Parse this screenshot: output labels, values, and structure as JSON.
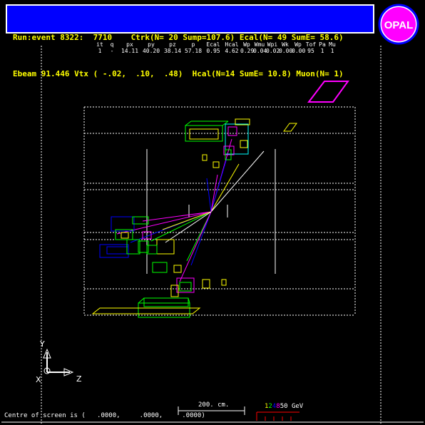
{
  "header": {
    "line1": "Run:event 8322:  7710    Ctrk(N= 20 Sump=107.6) Ecal(N= 49 SumE= 58.6)",
    "line2": "Ebeam 91.446 Vtx ( -.02,  .10,  .48)  Hcal(N=14 SumE= 10.8) Muon(N= 1)"
  },
  "logo": {
    "text": "OPAL"
  },
  "track_table": {
    "headers": [
      "it",
      "q",
      "px",
      "py",
      "pz",
      "p",
      "Ecal",
      "Hcal",
      "Wp",
      "Wmu",
      "Wpi",
      "Wk",
      "Wp",
      "Tof",
      "Pa",
      "Mu"
    ],
    "row": [
      "1",
      "-",
      "14.11",
      "40.20",
      "38.14",
      "57.18",
      "0.95",
      "4.62",
      "0.29",
      "0.04",
      "0.02",
      "0.00",
      "0.00",
      "95",
      "1",
      "1"
    ]
  },
  "axes": {
    "y_label": "Y",
    "x_label": "X",
    "z_label": "Z"
  },
  "scale": {
    "label": "200. cm."
  },
  "energy_scale": {
    "digits": [
      "1",
      "2",
      "4",
      "8",
      "50 GeV"
    ]
  },
  "footer": {
    "centre_text": "Centre of screen is (   .0000,     .0000,     .0000)"
  },
  "colors": {
    "background": "#000000",
    "header_bg": "#0000ff",
    "header_text": "#ffff00",
    "tracks": "#ff00ff",
    "ecal": "#00ff00",
    "hcal": "#ffff00",
    "muon": "#0000ff",
    "frame": "#ffffff"
  }
}
